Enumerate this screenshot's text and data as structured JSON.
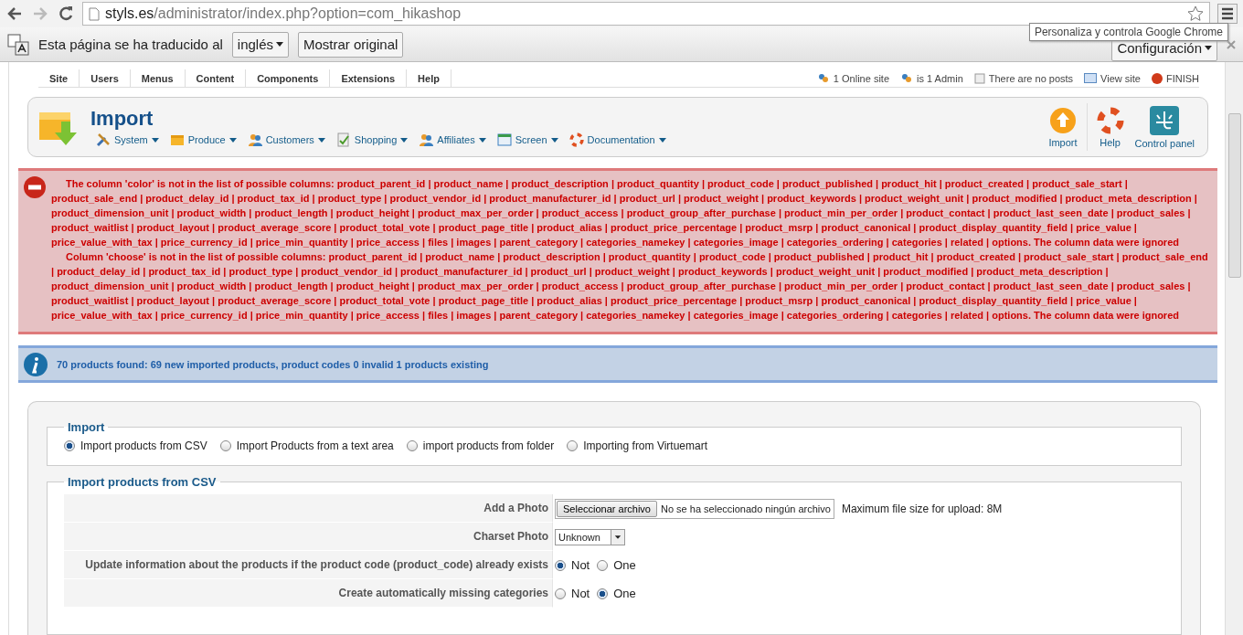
{
  "browser": {
    "url_host": "styls.es",
    "url_path": "/administrator/index.php?option=com_hikashop",
    "tooltip": "Personaliza y controla Google Chrome"
  },
  "translate_bar": {
    "message": "Esta página se ha traducido al",
    "language": "inglés",
    "show_original": "Mostrar original",
    "settings": "Configuración"
  },
  "admin_menu": {
    "items": [
      "Site",
      "Users",
      "Menus",
      "Content",
      "Components",
      "Extensions",
      "Help"
    ],
    "status": [
      {
        "kind": "users",
        "label": "1 Online site"
      },
      {
        "kind": "users",
        "label": "is 1 Admin"
      },
      {
        "kind": "posts",
        "label": "There are no posts"
      },
      {
        "kind": "view",
        "label": "View site"
      },
      {
        "kind": "finish",
        "label": "FINISH"
      }
    ]
  },
  "header": {
    "title": "Import",
    "menu": [
      {
        "kind": "tools",
        "label": "System"
      },
      {
        "kind": "box",
        "label": "Produce"
      },
      {
        "kind": "person",
        "label": "Customers"
      },
      {
        "kind": "doc",
        "label": "Shopping"
      },
      {
        "kind": "person",
        "label": "Affiliates"
      },
      {
        "kind": "screen",
        "label": "Screen"
      },
      {
        "kind": "ring",
        "label": "Documentation"
      }
    ],
    "buttons": [
      {
        "kind": "upload",
        "label": "Import"
      },
      {
        "kind": "ring",
        "label": "Help"
      },
      {
        "kind": "panel",
        "label": "Control panel"
      }
    ]
  },
  "error_messages": [
    "The column 'color' is not in the list of possible columns: product_parent_id | product_name | product_description | product_quantity | product_code | product_published | product_hit | product_created | product_sale_start | product_sale_end | product_delay_id | product_tax_id | product_type | product_vendor_id | product_manufacturer_id | product_url | product_weight | product_keywords | product_weight_unit | product_modified | product_meta_description | product_dimension_unit | product_width | product_length | product_height | product_max_per_order | product_access | product_group_after_purchase | product_min_per_order | product_contact | product_last_seen_date | product_sales | product_waitlist | product_layout | product_average_score | product_total_vote | product_page_title | product_alias | product_price_percentage | product_msrp | product_canonical | product_display_quantity_field | price_value | price_value_with_tax | price_currency_id | price_min_quantity | price_access | files | images | parent_category | categories_namekey | categories_image | categories_ordering | categories | related | options. The column data were ignored",
    "Column 'choose' is not in the list of possible columns: product_parent_id | product_name | product_description | product_quantity | product_code | product_published | product_hit | product_created | product_sale_start | product_sale_end | product_delay_id | product_tax_id | product_type | product_vendor_id | product_manufacturer_id | product_url | product_weight | product_keywords | product_weight_unit | product_modified | product_meta_description | product_dimension_unit | product_width | product_length | product_height | product_max_per_order | product_access | product_group_after_purchase | product_min_per_order | product_contact | product_last_seen_date | product_sales | product_waitlist | product_layout | product_average_score | product_total_vote | product_page_title | product_alias | product_price_percentage | product_msrp | product_canonical | product_display_quantity_field | price_value | price_value_with_tax | price_currency_id | price_min_quantity | price_access | files | images | parent_category | categories_namekey | categories_image | categories_ordering | categories | related | options. The column data were ignored"
  ],
  "info_message": "70 products found: 69 new imported products, product codes 0 invalid 1 products existing",
  "import_options": {
    "legend": "Import",
    "options": [
      {
        "label": "Import products from CSV",
        "selected": true
      },
      {
        "label": "Import Products from a text area",
        "selected": false
      },
      {
        "label": "import products from folder",
        "selected": false
      },
      {
        "label": "Importing from Virtuemart",
        "selected": false
      }
    ]
  },
  "csv": {
    "legend": "Import products from CSV",
    "rows": [
      {
        "kind": "file",
        "label": "Add a Photo",
        "button": "Seleccionar archivo",
        "file_status": "No se ha seleccionado ningún archivo",
        "note": "Maximum file size for upload: 8M"
      },
      {
        "kind": "select",
        "label": "Charset Photo",
        "value": "Unknown"
      },
      {
        "kind": "radio",
        "label": "Update information about the products if the product code (product_code) already exists",
        "options": [
          {
            "label": "Not",
            "selected": true
          },
          {
            "label": "One",
            "selected": false
          }
        ]
      },
      {
        "kind": "radio",
        "label": "Create automatically missing categories",
        "options": [
          {
            "label": "Not",
            "selected": false
          },
          {
            "label": "One",
            "selected": true
          }
        ]
      }
    ]
  }
}
